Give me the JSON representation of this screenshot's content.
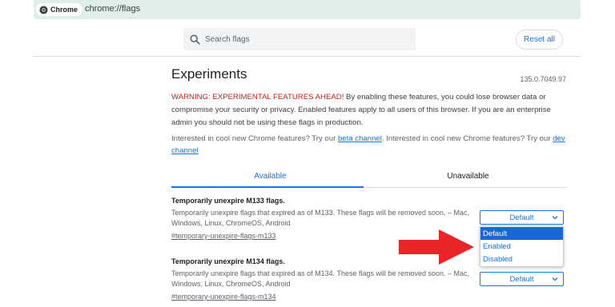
{
  "omnibox": {
    "chip_label": "Chrome",
    "url": "chrome://flags"
  },
  "search": {
    "placeholder": "Search flags",
    "icon": "search-icon"
  },
  "reset_button": "Reset all",
  "page": {
    "title": "Experiments",
    "version": "135.0.7049.97",
    "warning_prefix": "WARNING: EXPERIMENTAL FEATURES AHEAD!",
    "warning_body": " By enabling these features, you could lose browser data or compromise your security or privacy. Enabled features apply to all users of this browser. If you are an enterprise admin you should not be using these flags in production.",
    "interest_1": "Interested in cool new Chrome features? Try our ",
    "beta_link": "beta channel",
    "interest_2": ". Interested in cool new Chrome features? Try our ",
    "dev_link": "dev channel"
  },
  "tabs": {
    "available": "Available",
    "unavailable": "Unavailable",
    "active": "Available"
  },
  "flags": [
    {
      "title": "Temporarily unexpire M133 flags.",
      "description": "Temporarily unexpire flags that expired as of M133. These flags will be removed soon. – Mac, Windows, Linux, ChromeOS, Android",
      "link": "#temporary-unexpire-flags-m133",
      "value": "Default"
    },
    {
      "title": "Temporarily unexpire M134 flags.",
      "description": "Temporarily unexpire flags that expired as of M134. These flags will be removed soon. – Mac, Windows, Linux, ChromeOS, Android",
      "link": "#temporary-unexpire-flags-m134",
      "value": "Default"
    }
  ],
  "dropdown_options": [
    "Default",
    "Enabled",
    "Disabled"
  ],
  "colors": {
    "accent": "#1a73e8",
    "warning": "#c5221f",
    "selected_option_bg": "#1967d2",
    "omnibox_bg": "#dfeee8",
    "pointer_arrow": "#e8262a"
  }
}
